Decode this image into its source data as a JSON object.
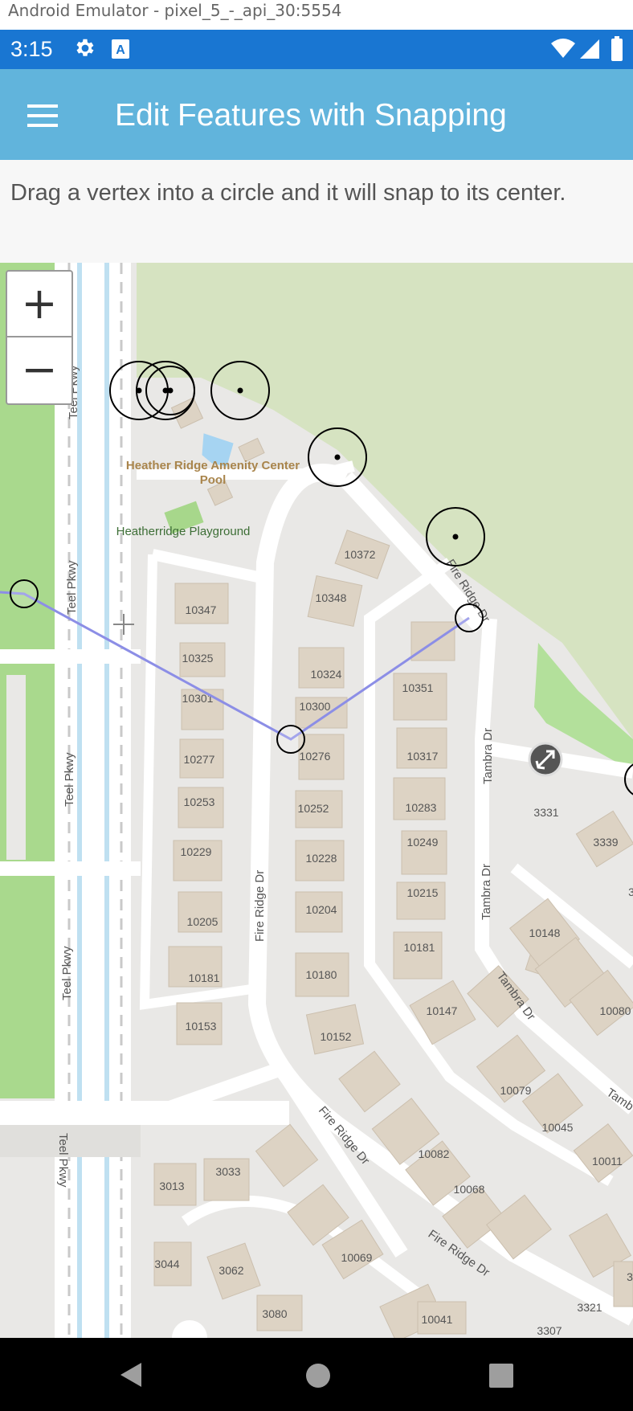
{
  "emulator": {
    "title": "Android Emulator - pixel_5_-_api_30:5554"
  },
  "status_bar": {
    "time": "3:15"
  },
  "app_bar": {
    "title": "Edit Features with Snapping"
  },
  "instructions": "Drag a vertex into a circle and it will snap to its center.",
  "zoom": {
    "in_label": "+",
    "out_label": "−"
  },
  "map": {
    "places": {
      "pool": "Heather Ridge Amenity Center",
      "pool_sub": "Pool",
      "playground": "Heatherridge Playground"
    },
    "streets": {
      "teel_1": "Teel Pkwy",
      "teel_2": "Teel Pkwy",
      "teel_3": "Teel Pkwy",
      "teel_4": "Teel Pkwy",
      "teel_5": "Teel Pkwy",
      "fire_1": "Fire Ridge Dr",
      "fire_2": "Fire Ridge Dr",
      "fire_3": "Fire Ridge Dr",
      "fire_4": "Fire Ridge Dr",
      "tambra_1": "Tambra Dr",
      "tambra_2": "Tambra Dr",
      "tambra_3": "Tambra Dr",
      "tambra_4": "Tamb"
    },
    "house_numbers": [
      "10372",
      "10348",
      "10347",
      "10325",
      "10324",
      "10301",
      "10300",
      "10351",
      "10277",
      "10276",
      "10317",
      "10253",
      "10252",
      "10283",
      "10229",
      "10228",
      "10249",
      "10205",
      "10204",
      "10215",
      "10181",
      "10180",
      "10181",
      "10153",
      "10152",
      "10147",
      "10148",
      "10080",
      "3331",
      "3339",
      "3",
      "10079",
      "10045",
      "10011",
      "10082",
      "10068",
      "3013",
      "3033",
      "10069",
      "3044",
      "3062",
      "3080",
      "10041",
      "3321",
      "3307",
      "3"
    ]
  }
}
